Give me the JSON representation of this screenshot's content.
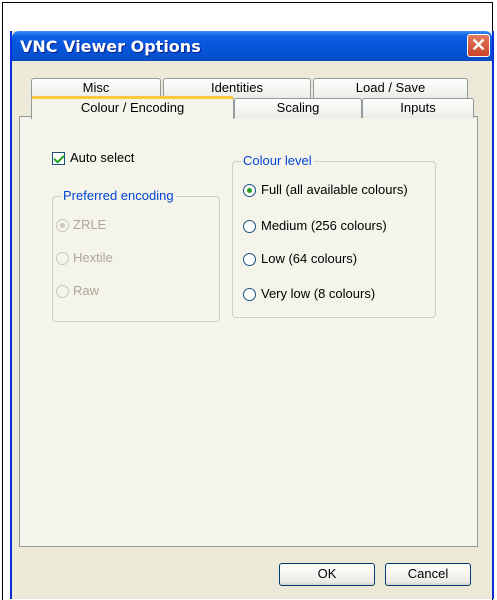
{
  "window": {
    "title": "VNC Viewer Options"
  },
  "tabs": {
    "row1": [
      "Misc",
      "Identities",
      "Load / Save"
    ],
    "row2": [
      "Colour / Encoding",
      "Scaling",
      "Inputs"
    ],
    "active": "Colour / Encoding"
  },
  "auto_select": {
    "label": "Auto select",
    "checked": true
  },
  "preferred_encoding": {
    "title": "Preferred encoding",
    "options": [
      "ZRLE",
      "Hextile",
      "Raw"
    ],
    "selected": "ZRLE",
    "disabled": true
  },
  "colour_level": {
    "title": "Colour level",
    "options": [
      "Full (all available colours)",
      "Medium (256 colours)",
      "Low (64 colours)",
      "Very low (8 colours)"
    ],
    "selected": "Full (all available colours)"
  },
  "buttons": {
    "ok": "OK",
    "cancel": "Cancel"
  },
  "colors": {
    "titlebar": "#0A5FE6",
    "accent_tab": "#FFC83C",
    "group_title": "#0046D5"
  }
}
